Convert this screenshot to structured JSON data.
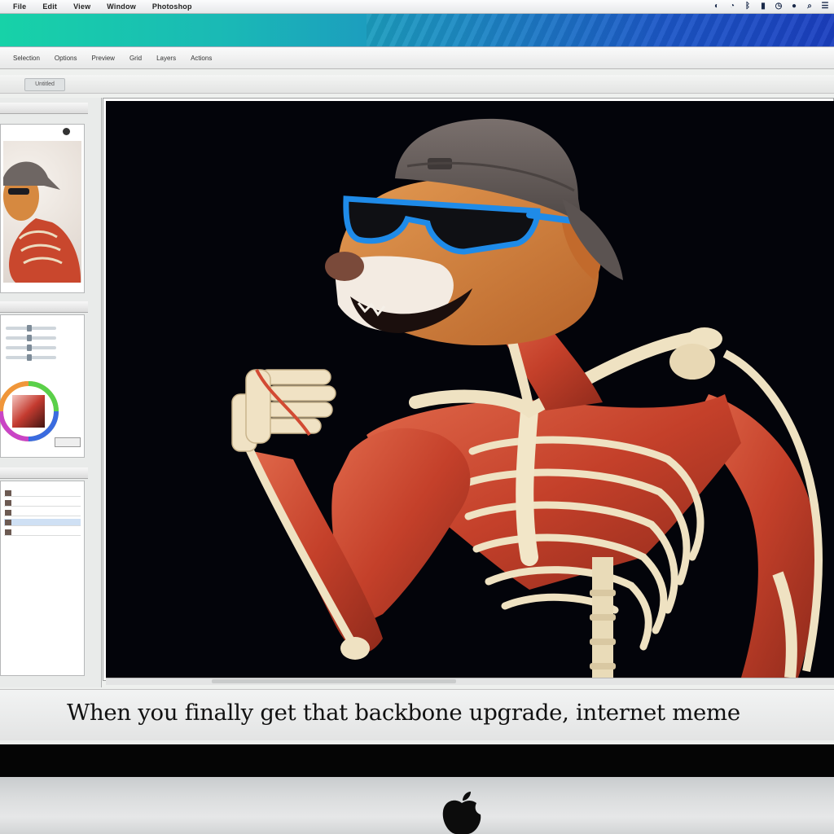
{
  "menubar": {
    "items": [
      "File",
      "Edit",
      "View",
      "Window",
      "Photoshop"
    ],
    "status_icons": [
      "volume-icon",
      "wifi-icon",
      "bluetooth-icon",
      "battery-icon",
      "clock-icon",
      "user-icon",
      "search-icon",
      "spotlight-icon"
    ]
  },
  "toolbar": {
    "items": [
      "Selection",
      "Options",
      "Preview",
      "Grid",
      "Layers",
      "Actions"
    ]
  },
  "tabstrip": {
    "doc_tab": "Untitled"
  },
  "caption": {
    "text": "When you finally get that backbone upgrade, internet meme"
  },
  "colors": {
    "canvas_bg": "#03040a",
    "wallpaper_left": "#17d2a8",
    "wallpaper_right": "#1b3fc0",
    "muscle": "#c7432a",
    "bone": "#efe2c2",
    "fur": "#d9853f",
    "cap": "#6e6563",
    "glasses": "#1f8be8"
  }
}
